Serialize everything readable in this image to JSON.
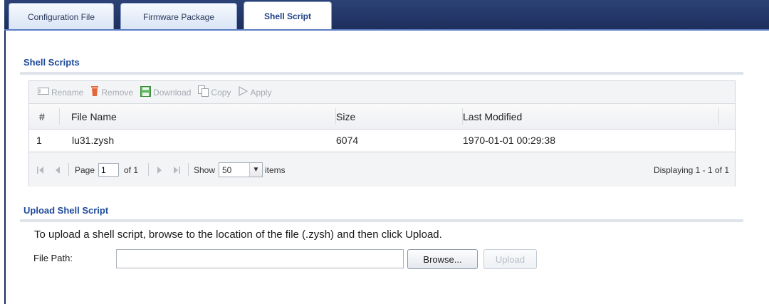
{
  "tabs": [
    {
      "label": "Configuration File",
      "active": false
    },
    {
      "label": "Firmware Package",
      "active": false
    },
    {
      "label": "Shell Script",
      "active": true
    }
  ],
  "shell_scripts": {
    "title": "Shell Scripts",
    "toolbar": {
      "rename": "Rename",
      "remove": "Remove",
      "download": "Download",
      "copy": "Copy",
      "apply": "Apply"
    },
    "columns": {
      "num": "#",
      "file_name": "File Name",
      "size": "Size",
      "last_modified": "Last Modified"
    },
    "rows": [
      {
        "num": "1",
        "file_name": "lu31.zysh",
        "size": "6074",
        "last_modified": "1970-01-01 00:29:38"
      }
    ],
    "pager": {
      "page_label": "Page",
      "page_value": "1",
      "of_label": "of 1",
      "show_label": "Show",
      "show_value": "50",
      "items_label": "items",
      "displaying": "Displaying 1 - 1 of 1"
    }
  },
  "upload": {
    "title": "Upload Shell Script",
    "instructions": "To upload a shell script, browse to the location of the file (.zysh) and then click Upload.",
    "file_path_label": "File Path:",
    "file_path_value": "",
    "browse_label": "Browse...",
    "upload_label": "Upload"
  },
  "colors": {
    "tab_bar": "#223667",
    "section_title": "#1e4a9a",
    "download_icon": "#5cb85c",
    "remove_icon": "#e2683c"
  }
}
